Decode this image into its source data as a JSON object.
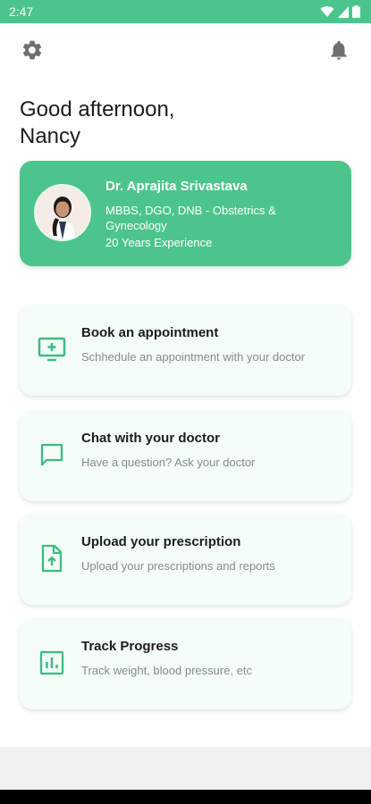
{
  "status_bar": {
    "time": "2:47",
    "bg_color": "#4cc58c",
    "icons": [
      "wifi-icon",
      "signal-icon",
      "battery-icon"
    ]
  },
  "topbar": {
    "left_icon": "gear-icon",
    "right_icon": "bell-icon"
  },
  "greeting": {
    "line1": "Good afternoon,",
    "line2": "Nancy"
  },
  "doctor": {
    "name": "Dr. Aprajita Srivastava",
    "qualifications": "MBBS, DGO, DNB - Obstetrics & Gynecology",
    "experience": "20 Years Experience",
    "card_color": "#4cc58c"
  },
  "actions": [
    {
      "title": "Book an appointment",
      "subtitle": "Schhedule an appointment with your doctor",
      "icon": "add-to-screen-icon"
    },
    {
      "title": "Chat with your doctor",
      "subtitle": "Have a question? Ask your doctor",
      "icon": "chat-icon"
    },
    {
      "title": "Upload your prescription",
      "subtitle": "Upload your prescriptions and reports",
      "icon": "upload-file-icon"
    },
    {
      "title": "Track Progress",
      "subtitle": "Track weight, blood pressure, etc",
      "icon": "chart-icon"
    }
  ],
  "accent_color": "#3dbb83"
}
